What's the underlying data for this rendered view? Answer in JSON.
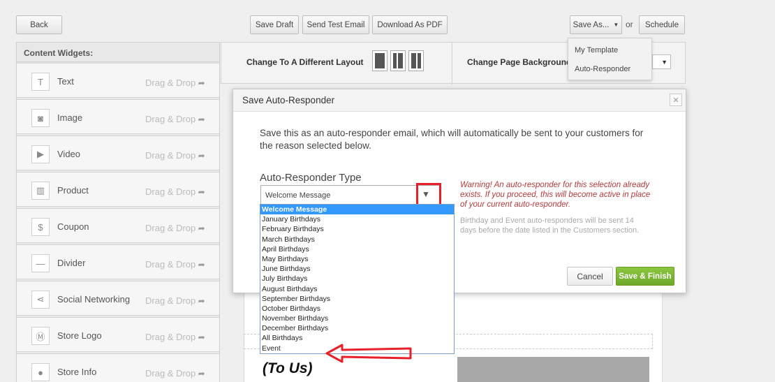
{
  "toolbar": {
    "back": "Back",
    "save_draft": "Save Draft",
    "send_test": "Send Test Email",
    "download_pdf": "Download As PDF",
    "save_as": "Save As...",
    "or": "or",
    "schedule": "Schedule"
  },
  "save_as_menu": {
    "items": [
      "My Template",
      "Auto-Responder"
    ]
  },
  "sidebar": {
    "header": "Content Widgets:",
    "drag_text": "Drag & Drop",
    "items": [
      {
        "label": "Text",
        "icon": "text-icon"
      },
      {
        "label": "Image",
        "icon": "camera-icon"
      },
      {
        "label": "Video",
        "icon": "play-icon"
      },
      {
        "label": "Product",
        "icon": "barcode-icon"
      },
      {
        "label": "Coupon",
        "icon": "coupon-icon"
      },
      {
        "label": "Divider",
        "icon": "divider-icon"
      },
      {
        "label": "Social Networking",
        "icon": "share-icon"
      },
      {
        "label": "Store Logo",
        "icon": "logo-icon"
      },
      {
        "label": "Store Info",
        "icon": "location-icon"
      }
    ]
  },
  "layout_bar": {
    "change_layout": "Change To A Different Layout",
    "change_background": "Change Page Background"
  },
  "canvas": {
    "heading": "(To Us)"
  },
  "dialog": {
    "title": "Save Auto-Responder",
    "description": "Save this as an auto-responder email, which will automatically be sent to your customers for the reason selected below.",
    "type_label": "Auto-Responder Type",
    "selected_value": "Welcome Message",
    "warning": "Warning! An auto-responder for this selection already exists. If you proceed, this will become active in place of your current auto-responder.",
    "note": "Birthday and Event auto-responders will be sent 14 days before the date listed in the Customers section.",
    "cancel": "Cancel",
    "save_finish": "Save & Finish",
    "options": [
      "Welcome Message",
      "January Birthdays",
      "February Birthdays",
      "March Birthdays",
      "April Birthdays",
      "May Birthdays",
      "June Birthdays",
      "July Birthdays",
      "August Birthdays",
      "September Birthdays",
      "October Birthdays",
      "November Birthdays",
      "December Birthdays",
      "All Birthdays",
      "Event"
    ]
  },
  "colors": {
    "accent_green": "#7cb832",
    "annotation_red": "#e8202a",
    "selected_blue": "#3399ff",
    "warning_red": "#b33a3a"
  }
}
